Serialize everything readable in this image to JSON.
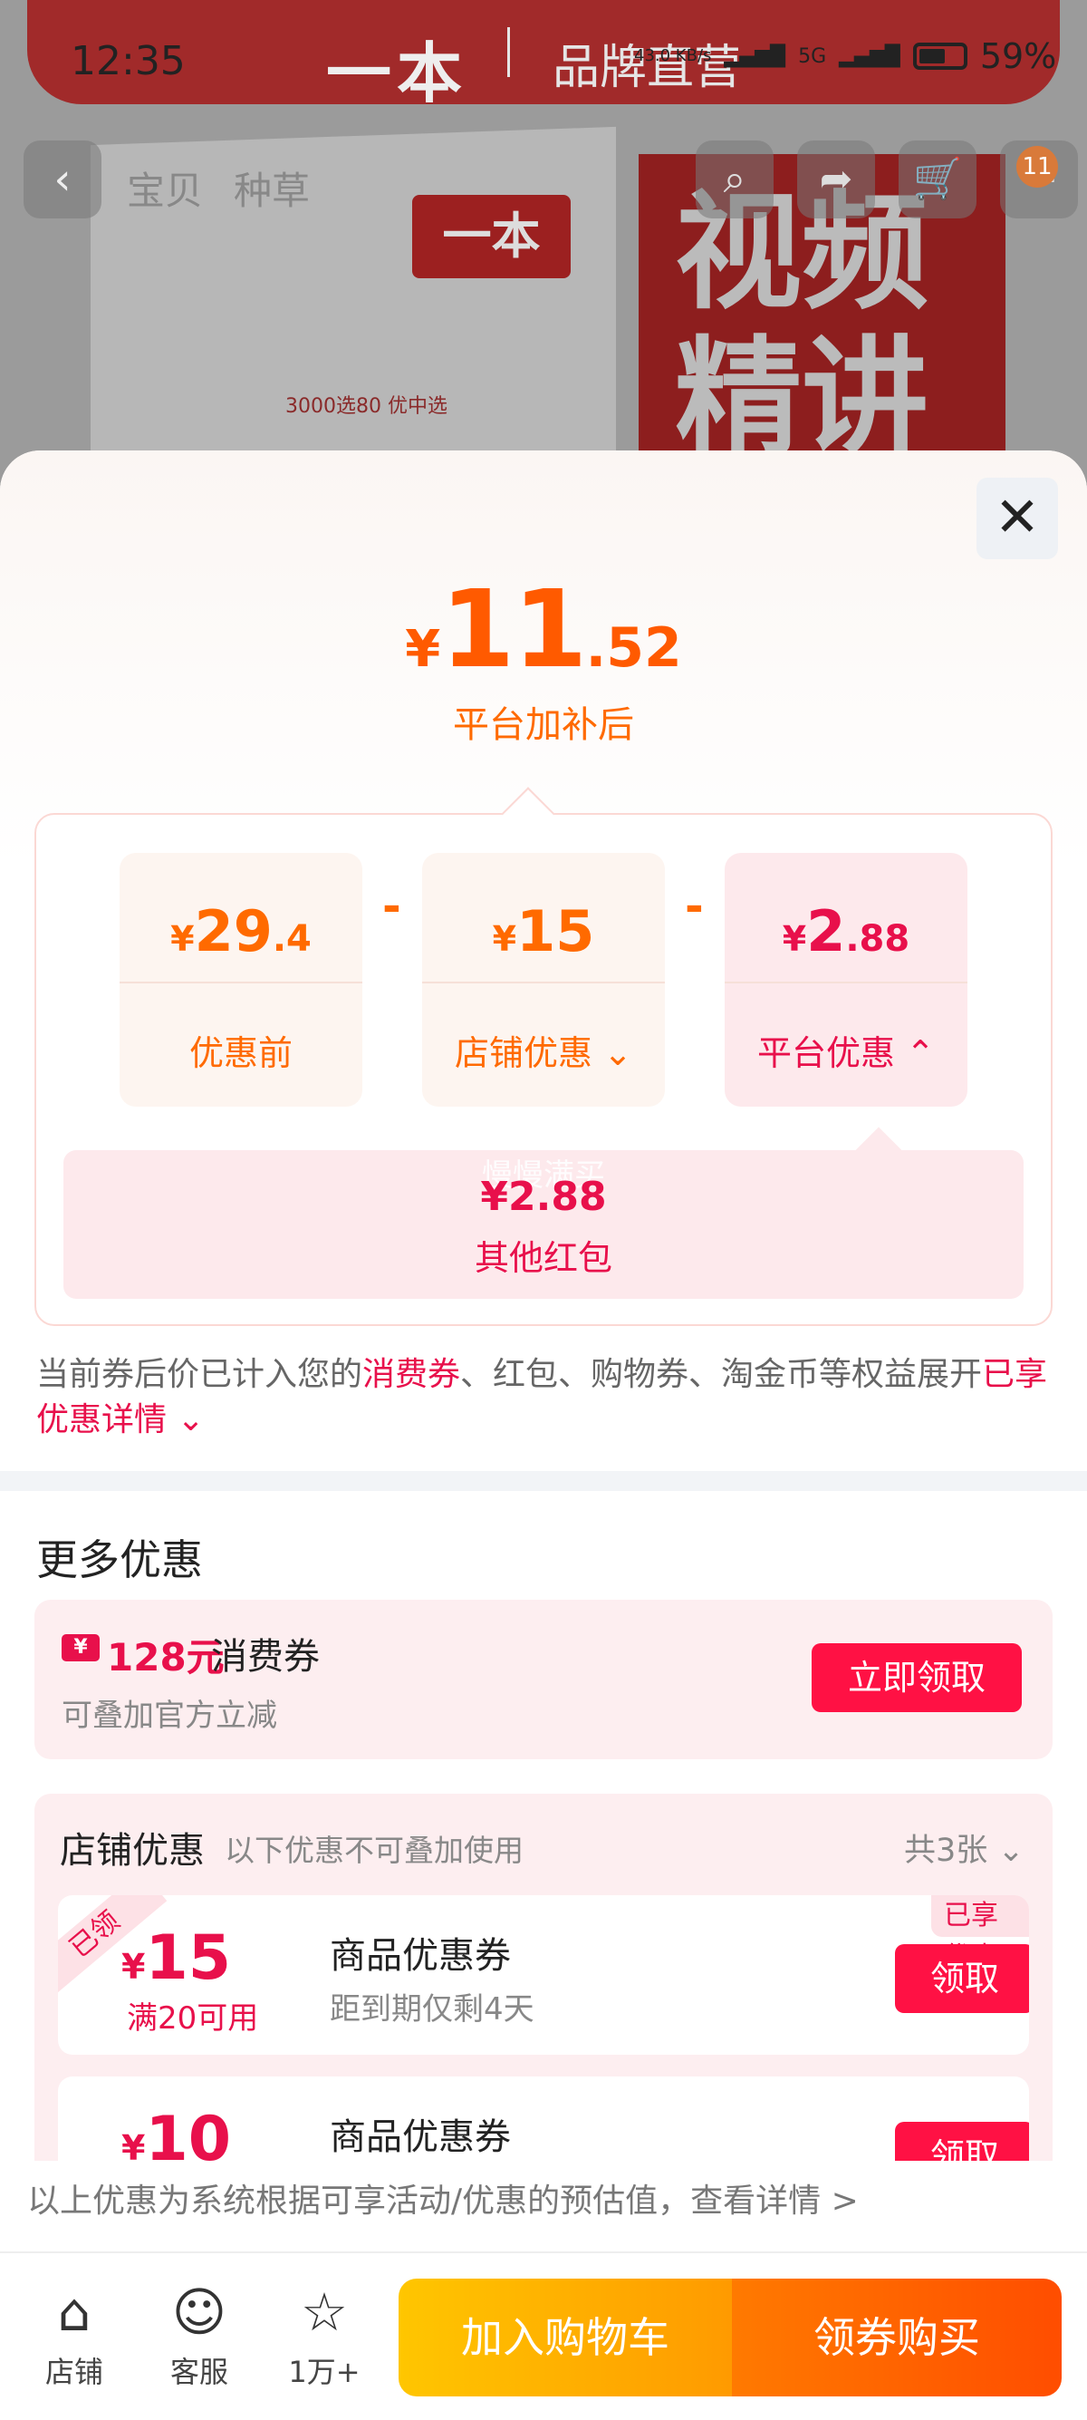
{
  "status_bar": {
    "time": "12:35",
    "speed": "43.0 KB/s",
    "network": "5G",
    "battery": "59%"
  },
  "background": {
    "brand_logo": "一本",
    "brand_sub": "品牌直营",
    "book_logo": "一本",
    "book_line": "3000选80    优中选",
    "video_text": "视频精讲"
  },
  "nav": {
    "tab_baobei": "宝贝",
    "tab_zhongcao": "种草",
    "cart_badge": "11"
  },
  "price": {
    "yen": "¥",
    "int": "11",
    "dec": ".52",
    "caption": "平台加补后"
  },
  "breakdown": {
    "before": {
      "y": "¥",
      "n": "29",
      "d": ".4",
      "label": "优惠前"
    },
    "shop": {
      "y": "¥",
      "n": "15",
      "d": "",
      "label": "店铺优惠"
    },
    "platform": {
      "y": "¥",
      "n": "2",
      "d": ".88",
      "label": "平台优惠"
    },
    "minus": "-"
  },
  "platform_detail": {
    "watermark": "慢慢满买",
    "amount": "¥2.88",
    "label": "其他红包"
  },
  "notice": {
    "part1": "当前券后价已计入您的",
    "highlight1": "消费券",
    "part2": "、红包、购物券、淘金币等权益展开",
    "highlight2": "已享优惠详情"
  },
  "more": {
    "title": "更多优惠"
  },
  "coupon128": {
    "icon": "¥",
    "amount": "128元",
    "kind": "消费券",
    "sub": "可叠加官方立减",
    "button": "立即领取"
  },
  "shop_coupons": {
    "title": "店铺优惠",
    "hint": "以下优惠不可叠加使用",
    "count": "共3张",
    "items": [
      {
        "ribbon": "已领",
        "y": "¥",
        "n": "15",
        "cond": "满20可用",
        "name": "商品优惠券",
        "expire": "距到期仅剩4天",
        "enjoyed": "已享优惠",
        "button": "领取"
      },
      {
        "ribbon": "",
        "y": "¥",
        "n": "10",
        "cond": "",
        "name": "商品优惠券",
        "expire": "",
        "enjoyed": "",
        "button": "领取"
      }
    ]
  },
  "footer_note": "以上优惠为系统根据可享活动/优惠的预估值，查看详情 >",
  "bottom_bar": {
    "shop": "店铺",
    "service": "客服",
    "fav": "1万+",
    "add_cart": "加入购物车",
    "buy": "领券购买"
  }
}
